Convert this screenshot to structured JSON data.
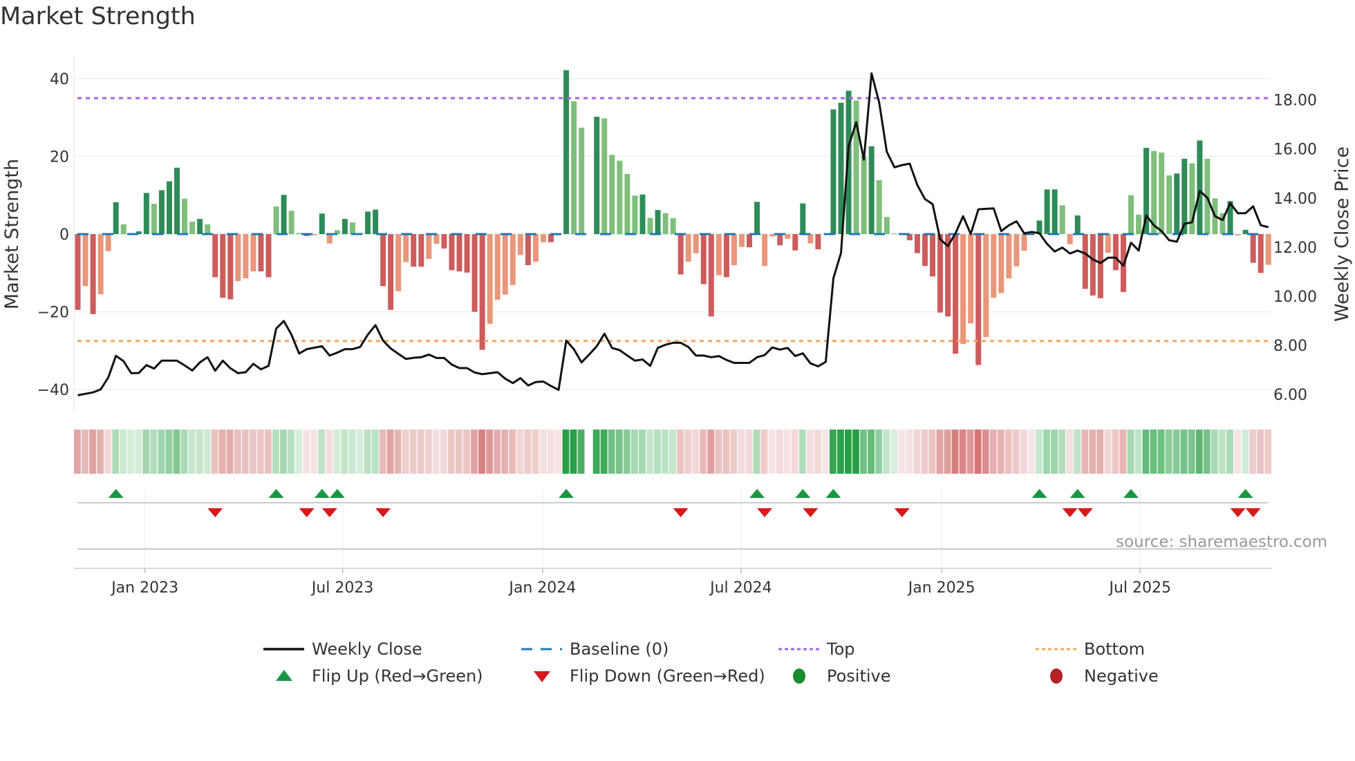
{
  "title": "Market Strength",
  "source": "source: sharemaestro.com",
  "chart_data": {
    "type": "bar",
    "title": "Market Strength",
    "ylabel": "Market Strength",
    "y2label": "Weekly Close Price",
    "ylim": [
      -44,
      44
    ],
    "y2lim": [
      5.75,
      19.6
    ],
    "yticks": [
      40,
      20,
      0,
      -20,
      -40
    ],
    "yticklabels": [
      "40",
      "20",
      "0",
      "−20",
      "−40"
    ],
    "y2ticks": [
      18,
      16,
      14,
      12,
      10,
      8,
      6
    ],
    "y2ticklabels": [
      "18.00",
      "16.00",
      "14.00",
      "12.00",
      "10.00",
      "8.00",
      "6.00"
    ],
    "xticks": [
      {
        "week": 8.8,
        "label": "Jan 2023"
      },
      {
        "week": 34.7,
        "label": "Jul 2023"
      },
      {
        "week": 60.9,
        "label": "Jan 2024"
      },
      {
        "week": 86.9,
        "label": "Jul 2024"
      },
      {
        "week": 113.2,
        "label": "Jan 2025"
      },
      {
        "week": 139.2,
        "label": "Jul 2025"
      }
    ],
    "top": 35,
    "bottom": -27.5,
    "baseline": 0,
    "strength": [
      -19.5,
      -13.4,
      -20.6,
      -15.5,
      -4.4,
      8.2,
      2.5,
      0.2,
      0.7,
      10.6,
      7.8,
      11.3,
      13.6,
      17.1,
      9.1,
      3.2,
      3.9,
      2.5,
      -11.1,
      -16.4,
      -16.8,
      -12.1,
      -11.4,
      -9.6,
      -9.6,
      -11.1,
      7.1,
      10.1,
      6.0,
      0.3,
      -0.5,
      -0.3,
      5.3,
      -2.4,
      1.0,
      3.9,
      3.0,
      0.3,
      5.8,
      6.3,
      -13.4,
      -19.5,
      -14.7,
      -7.2,
      -8.4,
      -8.4,
      -6.4,
      -2.5,
      -3.7,
      -9.3,
      -9.6,
      -9.9,
      -20.0,
      -29.8,
      -23.1,
      -16.9,
      -15.6,
      -13.1,
      -5.4,
      -8.0,
      -7.1,
      -2.1,
      -2.1,
      -0.3,
      42.2,
      34.2,
      27.4,
      0,
      30.2,
      29.8,
      20.4,
      18.9,
      15.5,
      9.9,
      10.2,
      4.2,
      6.2,
      5.4,
      4.1,
      -10.4,
      -7.1,
      -4.9,
      -12.9,
      -21.2,
      -10.6,
      -11.1,
      -8.0,
      -3.3,
      -3.4,
      8.3,
      -8.2,
      -0.6,
      -2.9,
      -1.2,
      -4.2,
      7.9,
      -2.4,
      -3.9,
      -0.2,
      32.1,
      33.8,
      36.9,
      34.4,
      20.0,
      22.6,
      13.9,
      4.4,
      0.2,
      -0.2,
      -1.6,
      -4.9,
      -8.2,
      -10.9,
      -20.2,
      -21.2,
      -30.8,
      -28.3,
      -23.0,
      -33.7,
      -26.5,
      -16.4,
      -15.2,
      -11.4,
      -8.3,
      -4.3,
      -0.2,
      3.5,
      11.5,
      11.5,
      7.4,
      -2.6,
      4.8,
      -14.1,
      -15.8,
      -16.5,
      -4.8,
      -9.3,
      -14.9,
      10.0,
      5.0,
      22.2,
      21.4,
      21.0,
      15.1,
      15.6,
      19.4,
      18.2,
      24.1,
      19.4,
      9.2,
      5.4,
      8.5,
      -0.3,
      1.1,
      -7.4,
      -10.0,
      -7.9
    ],
    "close": [
      5.96,
      6.02,
      6.08,
      6.2,
      6.69,
      7.57,
      7.35,
      6.86,
      6.87,
      7.19,
      7.05,
      7.37,
      7.37,
      7.37,
      7.18,
      6.97,
      7.3,
      7.51,
      6.96,
      7.37,
      7.06,
      6.86,
      6.9,
      7.24,
      7.02,
      7.16,
      8.68,
      8.99,
      8.43,
      7.66,
      7.84,
      7.9,
      7.96,
      7.58,
      7.7,
      7.84,
      7.84,
      7.93,
      8.43,
      8.82,
      8.19,
      7.87,
      7.65,
      7.44,
      7.49,
      7.51,
      7.62,
      7.48,
      7.48,
      7.21,
      7.07,
      7.07,
      6.89,
      6.82,
      6.86,
      6.9,
      6.64,
      6.46,
      6.66,
      6.36,
      6.5,
      6.52,
      6.34,
      6.18,
      8.19,
      7.84,
      7.3,
      7.62,
      7.96,
      8.47,
      7.89,
      7.8,
      7.58,
      7.37,
      7.42,
      7.16,
      7.89,
      8.02,
      8.1,
      8.1,
      7.93,
      7.58,
      7.58,
      7.51,
      7.56,
      7.4,
      7.28,
      7.28,
      7.28,
      7.51,
      7.6,
      7.91,
      7.82,
      7.89,
      7.56,
      7.67,
      7.26,
      7.14,
      7.32,
      10.73,
      11.76,
      16.12,
      17.09,
      15.56,
      19.08,
      17.9,
      15.89,
      15.25,
      15.34,
      15.4,
      14.53,
      13.96,
      13.75,
      12.32,
      12.04,
      12.56,
      13.26,
      12.53,
      13.54,
      13.56,
      13.58,
      12.65,
      12.89,
      13.05,
      12.56,
      12.62,
      12.56,
      12.13,
      11.82,
      11.98,
      11.74,
      11.86,
      11.74,
      11.5,
      11.35,
      11.57,
      11.57,
      11.24,
      12.18,
      11.86,
      13.29,
      12.89,
      12.65,
      12.28,
      12.22,
      12.95,
      13.01,
      14.29,
      14.01,
      13.26,
      13.1,
      13.79,
      13.38,
      13.38,
      13.66,
      12.89,
      12.81
    ],
    "flip_up": [
      5,
      26,
      32,
      34,
      64,
      89,
      95,
      99,
      126,
      131,
      138,
      153
    ],
    "flip_down": [
      18,
      30,
      33,
      40,
      79,
      90,
      96,
      108,
      130,
      132,
      152,
      154
    ],
    "legend": {
      "placement": "bottom",
      "entries": [
        {
          "key": "close",
          "label": "Weekly Close"
        },
        {
          "key": "baseline",
          "label": "Baseline (0)"
        },
        {
          "key": "top",
          "label": "Top"
        },
        {
          "key": "bottom",
          "label": "Bottom"
        },
        {
          "key": "flip_up",
          "label": "Flip Up (Red→Green)"
        },
        {
          "key": "flip_down",
          "label": "Flip Down (Green→Red)"
        },
        {
          "key": "positive",
          "label": "Positive"
        },
        {
          "key": "negative",
          "label": "Negative"
        }
      ]
    },
    "colors": {
      "pos_strong": "#2e8b57",
      "pos_weak": "#7fbf7b",
      "neg_strong": "#cd5c5c",
      "neg_weak": "#e9967a",
      "close": "#111111",
      "baseline": "#1f77b4",
      "top": "#9c6ade",
      "bottom": "#f4a460",
      "flip_up": "#1a9641",
      "flip_down": "#d7191c",
      "positive": "#1a8a2e",
      "negative": "#b22222"
    }
  }
}
